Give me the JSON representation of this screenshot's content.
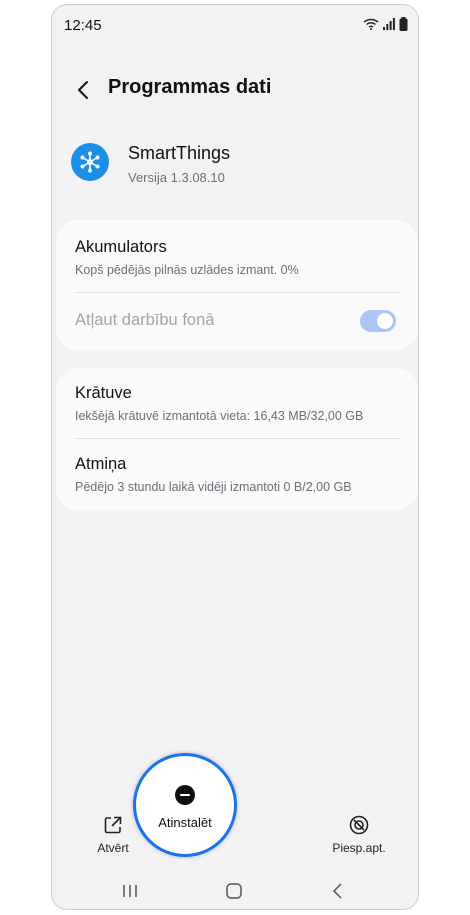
{
  "status": {
    "time": "12:45"
  },
  "header": {
    "title": "Programmas dati"
  },
  "app": {
    "name": "SmartThings",
    "version": "Versija 1.3.08.10",
    "icon": "smartthings-icon",
    "icon_color": "#1b8ee6"
  },
  "battery": {
    "title": "Akumulators",
    "subtitle": "Kopš pēdējās pilnās uzlādes izmant. 0%",
    "background_label": "Atļaut darbību fonā",
    "background_enabled": true
  },
  "storage": {
    "title": "Krātuve",
    "subtitle": "Iekšējā krātuvē izmantotā vieta: 16,43 MB/32,00 GB"
  },
  "memory": {
    "title": "Atmiņa",
    "subtitle": "Pēdējo 3 stundu laikā vidēji izmantoti 0 B/2,00 GB"
  },
  "actions": {
    "open_label": "Atvērt",
    "uninstall_label": "Atinstalēt",
    "force_stop_label": "Piesp.apt."
  },
  "colors": {
    "accent": "#1a73e8",
    "toggle_on": "#a9c7f2",
    "background": "#f2f2f4"
  }
}
